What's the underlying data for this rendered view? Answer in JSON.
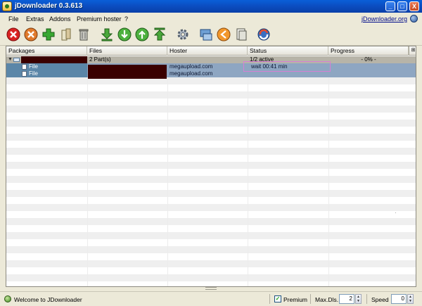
{
  "window": {
    "title": "jDownloader  0.3.613",
    "min_label": "_",
    "max_label": "□",
    "close_label": "X"
  },
  "menu": {
    "items": [
      "File",
      "Extras",
      "Addons",
      "Premium hoster",
      "?"
    ],
    "link": "jDownloader.org"
  },
  "toolbar": {
    "icons": [
      "stop-all-icon",
      "remove-icon",
      "add-icon",
      "clipboard-icon",
      "trash-icon",
      "move-bottom-icon",
      "move-down-icon",
      "move-up-icon",
      "move-top-icon",
      "settings-icon",
      "reconnect-icon",
      "clipboard-observer-icon",
      "copy-icon",
      "update-icon"
    ]
  },
  "grid": {
    "columns": [
      "Packages",
      "Files",
      "Hoster",
      "Status",
      "Progress"
    ],
    "corner_label": "⊞",
    "package_row": {
      "toggle": "▼",
      "files": "2 Part(s)",
      "hoster": "",
      "status": "1/2 active",
      "progress": "- 0% -"
    },
    "file_rows": [
      {
        "name": "File",
        "hoster": "megaupload.com",
        "status": "wait 00:41 min"
      },
      {
        "name": "File",
        "hoster": "megaupload.com",
        "status": ""
      }
    ]
  },
  "statusbar": {
    "message": "Welcome to JDownloader",
    "premium_checked": "✓",
    "premium_label": "Premium",
    "max_dls_label": "Max.Dls.",
    "max_dls_value": "2",
    "speed_label": "Speed",
    "speed_value": "0"
  },
  "colors": {
    "titlebar": "#0b4ec2",
    "package_row": "#b7b4a8",
    "file_row": "#8ea6c2",
    "highlight": "#d77fd4"
  }
}
